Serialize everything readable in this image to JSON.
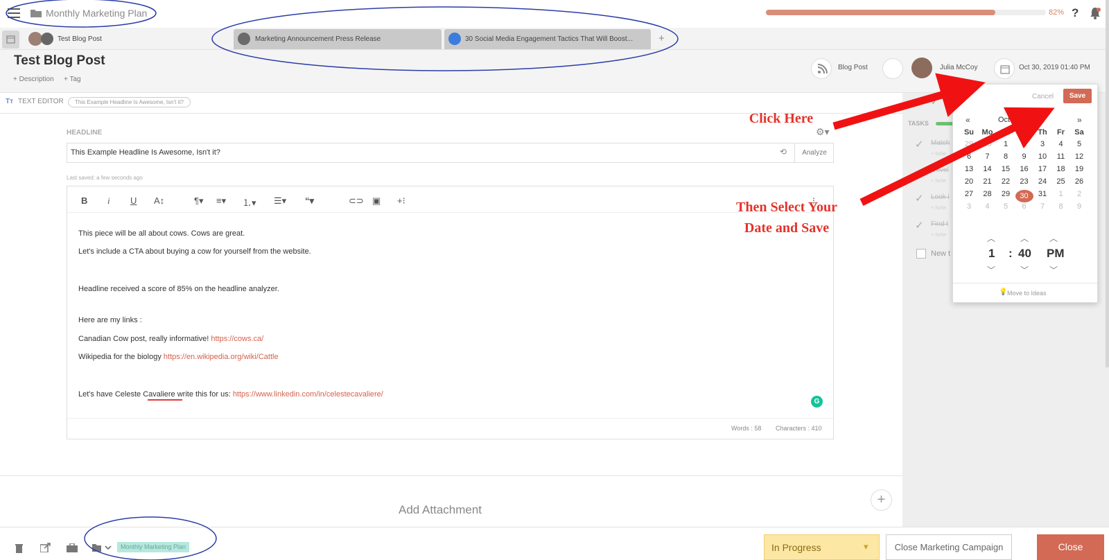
{
  "topbar": {
    "campaign_title": "Monthly Marketing Plan",
    "progress": 0.82,
    "progress_label": "82%"
  },
  "tabs": [
    {
      "label": "Test Blog Post",
      "active": true
    },
    {
      "label": "Marketing Announcement Press Release",
      "active": false
    },
    {
      "label": "30 Social Media Engagement Tactics That Will Boost...",
      "active": false
    }
  ],
  "header": {
    "title": "Test Blog Post",
    "add_description": "+ Description",
    "add_tag": "+ Tag",
    "content_type": "Blog Post",
    "author": "Julia McCoy",
    "due_date": "Oct 30, 2019 01:40 PM"
  },
  "editor": {
    "section_label": "TEXT EDITOR",
    "headline_pill": "This Example Headline Is Awesome, Isn't it?",
    "headline_label": "HEADLINE",
    "headline_value": "This Example Headline Is Awesome, Isn't it?",
    "analyze_label": "Analyze",
    "last_saved": "Last saved: a few seconds ago",
    "body": {
      "l1": "This piece will be all about cows. Cows are great.",
      "l2": "Let's include a CTA about buying a cow for yourself from the website.",
      "l3": "Headline received a score of 85% on the headline analyzer.",
      "l4": "Here are my links :",
      "l5_text": "Canadian Cow post, really informative! ",
      "l5_link": "https://cows.ca/",
      "l6_text": "Wikipedia for the biology ",
      "l6_link": "https://en.wikipedia.org/wiki/Cattle",
      "l7_text": "Let's have Celeste Cavaliere write this for us: ",
      "l7_link": "https://www.linkedin.com/in/celestecavaliere/"
    },
    "words": "Words : 58",
    "characters": "Characters : 410"
  },
  "attachment_label": "Add Attachment",
  "tasks": {
    "label": "TASKS",
    "items": [
      {
        "name": "Match",
        "sub": "+ Sche"
      },
      {
        "name": "Devel",
        "sub": "+ Sche"
      },
      {
        "name": "Look i",
        "sub": "+ Sche"
      },
      {
        "name": "Find t",
        "sub": "+ Sche"
      }
    ],
    "new_task": "New t"
  },
  "datepicker": {
    "cancel": "Cancel",
    "save": "Save",
    "prev": "«",
    "next": "»",
    "month": "October 2019",
    "weekdays": [
      "Su",
      "Mo",
      "Tu",
      "We",
      "Th",
      "Fr",
      "Sa"
    ],
    "weeks": [
      [
        "29",
        "30",
        "1",
        "2",
        "3",
        "4",
        "5"
      ],
      [
        "6",
        "7",
        "8",
        "9",
        "10",
        "11",
        "12"
      ],
      [
        "13",
        "14",
        "15",
        "16",
        "17",
        "18",
        "19"
      ],
      [
        "20",
        "21",
        "22",
        "23",
        "24",
        "25",
        "26"
      ],
      [
        "27",
        "28",
        "29",
        "30",
        "31",
        "1",
        "2"
      ],
      [
        "3",
        "4",
        "5",
        "6",
        "7",
        "8",
        "9"
      ]
    ],
    "hour": "1",
    "colon": ":",
    "minute": "40",
    "ampm": "PM",
    "move_to_ideas": "Move to Ideas"
  },
  "annotations": {
    "click_here": "Click Here",
    "select_date_1": "Then Select Your",
    "select_date_2": "Date and Save"
  },
  "bottombar": {
    "bucket_tag": "Monthly Marketing Plan",
    "status": "In Progress",
    "close_campaign": "Close Marketing Campaign",
    "close": "Close"
  },
  "colors": {
    "accent": "#d26a55",
    "annotation_red": "#e3332a",
    "ellipse_blue": "#2b3ca8",
    "status_yellow": "#fde7a5"
  }
}
